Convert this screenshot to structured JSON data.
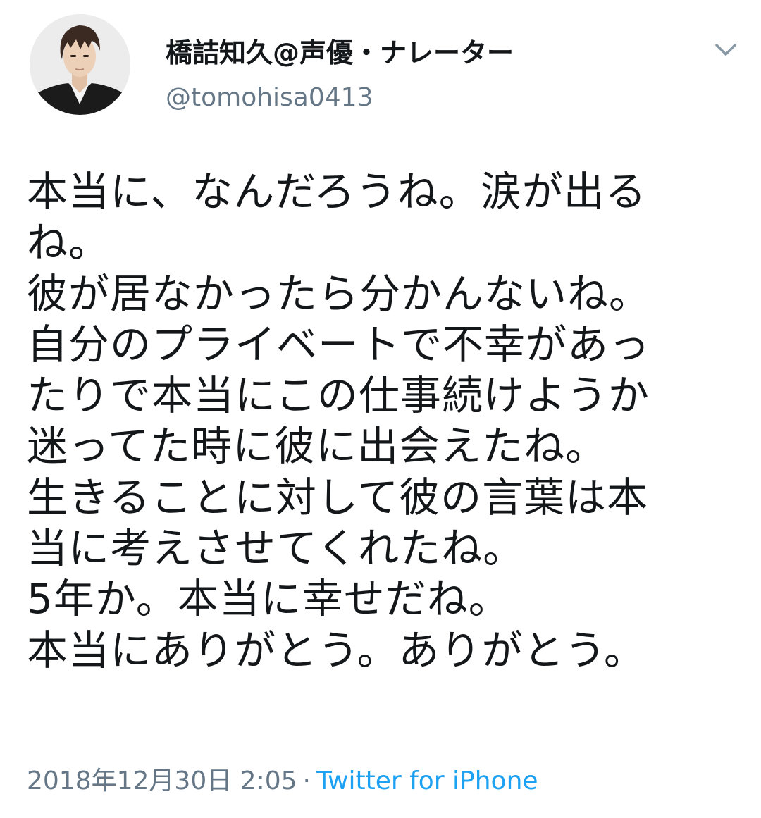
{
  "tweet": {
    "author": {
      "display_name": "橋詰知久@声優・ナレーター",
      "handle": "@tomohisa0413"
    },
    "text_lines": [
      "本当に、なんだろうね。涙が出る",
      "ね。",
      "彼が居なかったら分かんないね。",
      "自分のプライベートで不幸があっ",
      "たりで本当にこの仕事続けようか",
      "迷ってた時に彼に出会えたね。",
      "生きることに対して彼の言葉は本",
      "当に考えさせてくれたね。",
      "5年か。本当に幸せだね。",
      "本当にありがとう。ありがとう。"
    ],
    "timestamp": "2018年12月30日 2:05",
    "separator": "·",
    "source": "Twitter for iPhone",
    "menu_icon": "chevron-down-icon"
  },
  "colors": {
    "text": "#14171a",
    "secondary": "#657786",
    "link": "#1da1f2"
  }
}
